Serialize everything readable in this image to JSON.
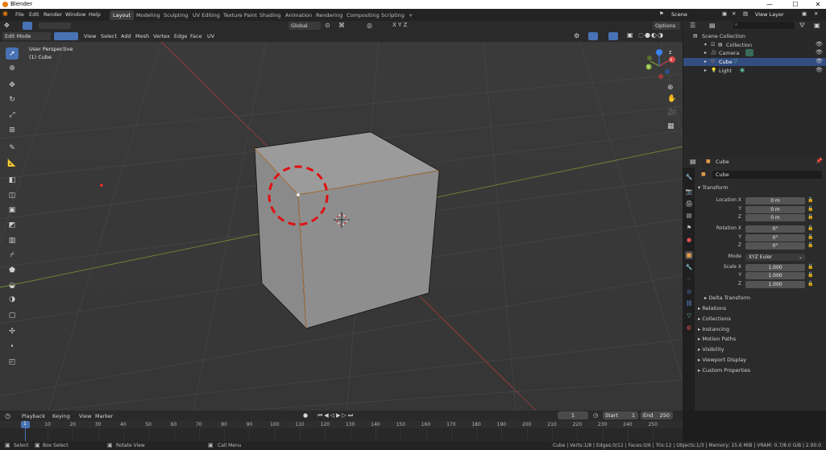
{
  "window": {
    "title": "Blender",
    "minimize": "—",
    "maximize": "☐",
    "close": "✕"
  },
  "topbar": {
    "menus": [
      "File",
      "Edit",
      "Render",
      "Window",
      "Help"
    ],
    "workspaces": [
      "Layout",
      "Modeling",
      "Sculpting",
      "UV Editing",
      "Texture Paint",
      "Shading",
      "Animation",
      "Rendering",
      "Compositing",
      "Scripting"
    ],
    "add_tab": "+",
    "scene": "Scene",
    "view_layer": "View Layer"
  },
  "viewport_header": {
    "mode": "Edit Mode",
    "menus": [
      "View",
      "Select",
      "Add",
      "Mesh",
      "Vertex",
      "Edge",
      "Face",
      "UV"
    ],
    "orientation": "Global",
    "options": "Options"
  },
  "viewport": {
    "perspective": "User Perspective",
    "object": "(1) Cube",
    "gizmo": {
      "x": "X",
      "y": "Y",
      "z": "Z"
    }
  },
  "outliner": {
    "search_placeholder": "",
    "items": [
      {
        "label": "Scene Collection",
        "indent": 0
      },
      {
        "label": "Collection",
        "indent": 1
      },
      {
        "label": "Camera",
        "indent": 2
      },
      {
        "label": "Cube",
        "indent": 2,
        "selected": true
      },
      {
        "label": "Light",
        "indent": 2
      }
    ]
  },
  "properties": {
    "object_name_header": "Cube",
    "object_name_field": "Cube",
    "transform_title": "Transform",
    "location": {
      "label_x": "Location X",
      "y": "Y",
      "z": "Z",
      "vx": "0 m",
      "vy": "0 m",
      "vz": "0 m"
    },
    "rotation": {
      "label_x": "Rotation X",
      "y": "Y",
      "z": "Z",
      "vx": "0°",
      "vy": "0°",
      "vz": "0°"
    },
    "mode_label": "Mode",
    "mode_value": "XYZ Euler",
    "scale": {
      "label_x": "Scale X",
      "y": "Y",
      "z": "Z",
      "vx": "1.000",
      "vy": "1.000",
      "vz": "1.000"
    },
    "delta_transform": "Delta Transform",
    "panels": [
      "Relations",
      "Collections",
      "Instancing",
      "Motion Paths",
      "Visibility",
      "Viewport Display",
      "Custom Properties"
    ]
  },
  "timeline": {
    "menus": [
      "Playback",
      "Keying",
      "View",
      "Marker"
    ],
    "current_frame": "1",
    "start_label": "Start",
    "start": "1",
    "end_label": "End",
    "end": "250",
    "ticks": [
      "1",
      "10",
      "20",
      "30",
      "40",
      "50",
      "60",
      "70",
      "80",
      "90",
      "100",
      "110",
      "120",
      "130",
      "140",
      "150",
      "160",
      "170",
      "180",
      "190",
      "200",
      "210",
      "220",
      "230",
      "240",
      "250"
    ]
  },
  "statusbar": {
    "select": "Select",
    "box_select": "Box Select",
    "rotate_view": "Rotate View",
    "call_menu": "Call Menu",
    "stats": "Cube | Verts:1/8 | Edges:0/12 | Faces:0/6 | Tris:12 | Objects:1/3 | Memory: 15.6 MiB | VRAM: 0.7/8.0 GiB | 2.90.0"
  }
}
